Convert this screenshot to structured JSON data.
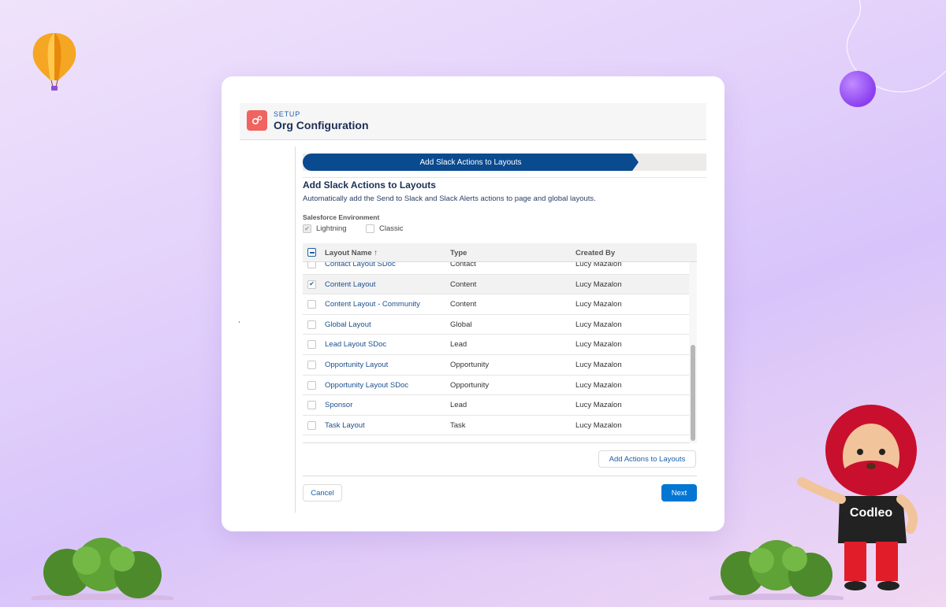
{
  "header": {
    "setup_label": "SETUP",
    "title": "Org Configuration"
  },
  "progress": {
    "active_step": "Add Slack Actions to Layouts"
  },
  "step": {
    "title": "Add Slack Actions to Layouts",
    "description": "Automatically add the Send to Slack and Slack Alerts actions to page and global layouts.",
    "env_label": "Salesforce Environment",
    "env_options": [
      {
        "label": "Lightning",
        "checked": true,
        "disabled": true
      },
      {
        "label": "Classic",
        "checked": false,
        "disabled": false
      }
    ]
  },
  "table": {
    "columns": [
      "Layout Name ↑",
      "Type",
      "Created By"
    ],
    "rows": [
      {
        "name": "Contact Layout SDoc",
        "type": "Contact",
        "created_by": "Lucy Mazalon",
        "checked": false
      },
      {
        "name": "Content Layout",
        "type": "Content",
        "created_by": "Lucy Mazalon",
        "checked": true
      },
      {
        "name": "Content Layout - Community",
        "type": "Content",
        "created_by": "Lucy Mazalon",
        "checked": false
      },
      {
        "name": "Global Layout",
        "type": "Global",
        "created_by": "Lucy Mazalon",
        "checked": false
      },
      {
        "name": "Lead Layout SDoc",
        "type": "Lead",
        "created_by": "Lucy Mazalon",
        "checked": false
      },
      {
        "name": "Opportunity Layout",
        "type": "Opportunity",
        "created_by": "Lucy Mazalon",
        "checked": false
      },
      {
        "name": "Opportunity Layout SDoc",
        "type": "Opportunity",
        "created_by": "Lucy Mazalon",
        "checked": false
      },
      {
        "name": "Sponsor",
        "type": "Lead",
        "created_by": "Lucy Mazalon",
        "checked": false
      },
      {
        "name": "Task Layout",
        "type": "Task",
        "created_by": "Lucy Mazalon",
        "checked": false
      }
    ]
  },
  "buttons": {
    "add": "Add Actions to Layouts",
    "cancel": "Cancel",
    "next": "Next"
  },
  "nav": {
    "prev_icon": "‹",
    "next_icon": "›"
  },
  "mascot": {
    "shirt_text": "Codleo"
  },
  "colors": {
    "brand_blue": "#0a4a8f",
    "button_blue": "#0176d3",
    "setup_icon": "#f0635e"
  }
}
